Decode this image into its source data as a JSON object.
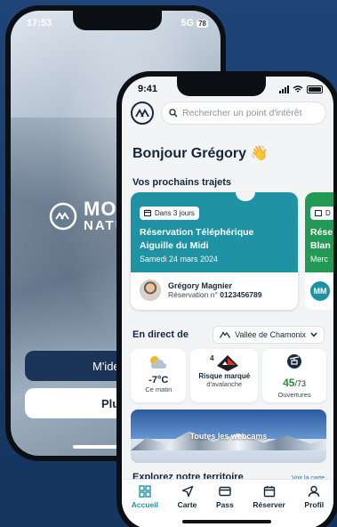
{
  "back_phone": {
    "time": "17:53",
    "network": "5G",
    "battery": "78",
    "brand_line1": "MON",
    "brand_line2": "NATUR",
    "btn_identify": "M'iden",
    "btn_more": "Plus"
  },
  "front_phone": {
    "time": "9:41",
    "search_placeholder": "Rechercher un point d'intérêt",
    "greeting": "Bonjour Grégory",
    "greeting_emoji": "👋",
    "upcoming_title": "Vos prochains trajets",
    "card": {
      "badge": "Dans 3 jours",
      "title": "Réservation Téléphérique Aiguille du Midi",
      "date": "Samedi 24 mars 2024",
      "person_name": "Grégory Magnier",
      "reservation_prefix": "Réservation n°",
      "reservation_number": "0123456789"
    },
    "card2": {
      "badge_fragment": "D",
      "title_fragment_1": "Rése",
      "title_fragment_2": "Blan",
      "date_fragment": "Merc",
      "initials": "MM"
    },
    "live": {
      "label": "En direct  de",
      "valley": "Vallée de Chamonix",
      "temperature": "-7°C",
      "temperature_caption": "Ce matin",
      "avalanche_level": "4",
      "avalanche_title": "Risque marqué",
      "avalanche_caption": "d'avalanche",
      "openings_count": "45",
      "openings_total": "/73",
      "openings_caption": "Ouvertures"
    },
    "webcam_label": "Toutes les webcams",
    "explore_title": "Explorez notre territoire",
    "explore_link": "Voir la carte",
    "tabs": [
      {
        "label": "Accueil",
        "icon": "grid-icon"
      },
      {
        "label": "Carte",
        "icon": "navigation-icon"
      },
      {
        "label": "Pass",
        "icon": "pass-card-icon"
      },
      {
        "label": "Réserver",
        "icon": "calendar-icon"
      },
      {
        "label": "Profil",
        "icon": "user-icon"
      }
    ],
    "colors": {
      "accent": "#1f93a3",
      "card2": "#229955",
      "primary_text": "#15263b",
      "openings": "#2e8b3a"
    }
  }
}
